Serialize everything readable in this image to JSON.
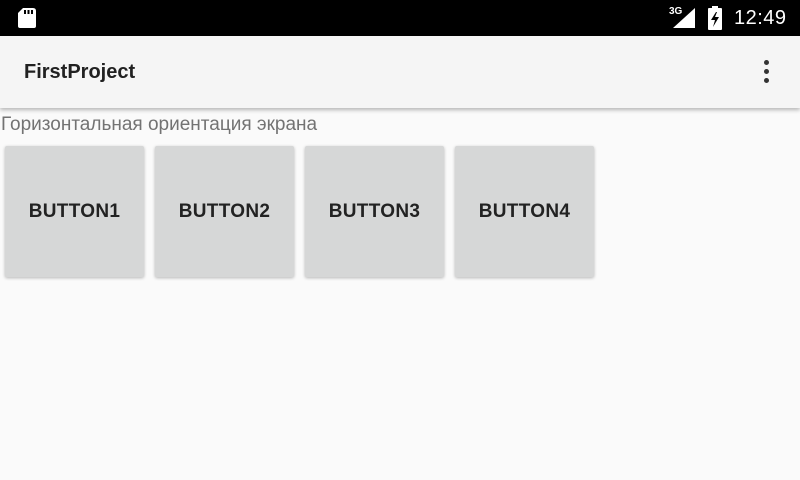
{
  "status_bar": {
    "network_type": "3G",
    "time": "12:49",
    "icons": [
      "sd-card-icon",
      "signal-icon",
      "battery-charging-icon"
    ]
  },
  "app_bar": {
    "title": "FirstProject",
    "menu_icon": "overflow-menu-icon"
  },
  "content": {
    "orientation_text": "Горизонтальная ориентация экрана",
    "buttons": [
      {
        "label": "BUTTON1"
      },
      {
        "label": "BUTTON2"
      },
      {
        "label": "BUTTON3"
      },
      {
        "label": "BUTTON4"
      }
    ]
  },
  "colors": {
    "status_bar": "#000000",
    "app_bar": "#f5f5f5",
    "background": "#fafafa",
    "button": "#d6d7d7",
    "secondary_text": "#737373"
  }
}
